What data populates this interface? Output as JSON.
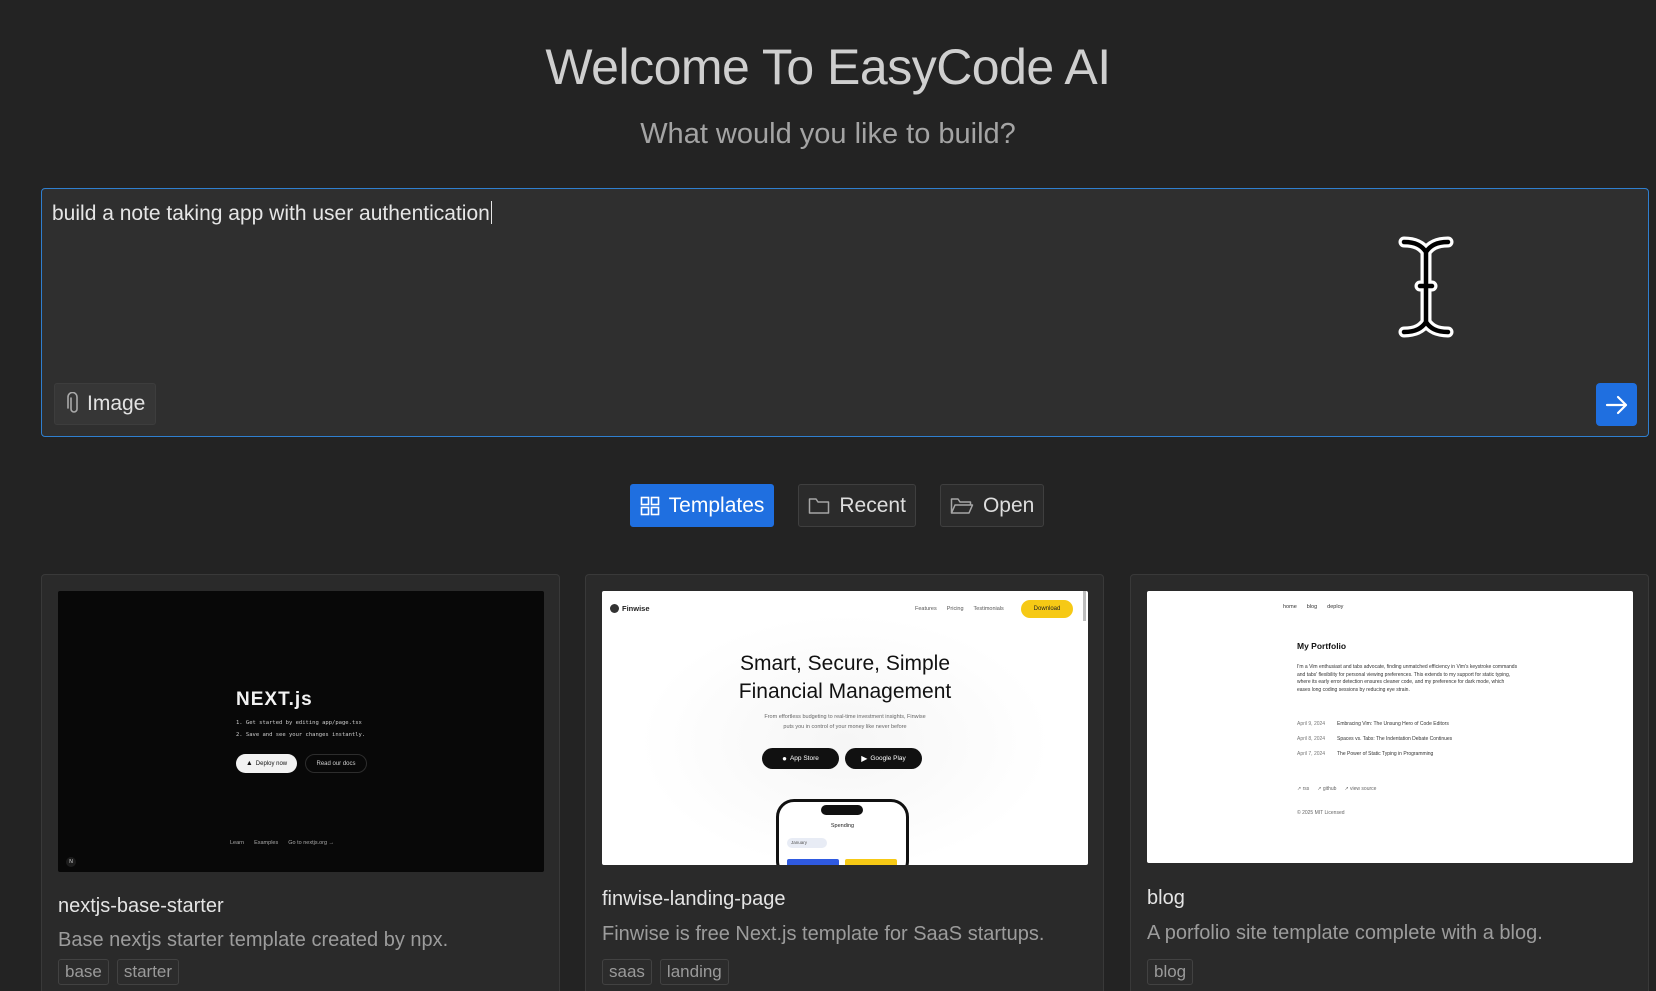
{
  "header": {
    "title": "Welcome To EasyCode AI",
    "subtitle": "What would you like to build?"
  },
  "prompt": {
    "value": "build a note taking app with user authentication",
    "image_button_label": "Image",
    "attach_icon": "paperclip-icon",
    "send_icon": "arrow-right-icon"
  },
  "tabs": [
    {
      "label": "Templates",
      "icon": "grid-icon",
      "active": true
    },
    {
      "label": "Recent",
      "icon": "folder-icon",
      "active": false
    },
    {
      "label": "Open",
      "icon": "folder-open-icon",
      "active": false
    }
  ],
  "templates": [
    {
      "name": "nextjs-base-starter",
      "description": "Base nextjs starter template created by npx.",
      "tags": [
        "base",
        "starter"
      ],
      "preview": {
        "logo": "NEXT.js",
        "step1": "1. Get started by editing app/page.tsx",
        "step2": "2. Save and see your changes instantly.",
        "primary_btn": "Deploy now",
        "secondary_btn": "Read our docs",
        "footer": [
          "Learn",
          "Examples",
          "Go to nextjs.org →"
        ]
      }
    },
    {
      "name": "finwise-landing-page",
      "description": "Finwise is free Next.js template for SaaS startups.",
      "tags": [
        "saas",
        "landing"
      ],
      "preview": {
        "brand": "Finwise",
        "nav": [
          "Features",
          "Pricing",
          "Testimonials"
        ],
        "cta": "Download",
        "headline_1": "Smart, Secure, Simple",
        "headline_2": "Financial Management",
        "body_1": "From effortless budgeting to real-time investment insights, Finwise",
        "body_2": "puts you in control of your money like never before",
        "store_1": "App Store",
        "store_2": "Google Play",
        "phone_label": "Spending",
        "phone_select": "January"
      }
    },
    {
      "name": "blog",
      "description": "A porfolio site template complete with a blog.",
      "tags": [
        "blog"
      ],
      "preview": {
        "nav": [
          "home",
          "blog",
          "deploy"
        ],
        "heading": "My Portfolio",
        "bio": "I'm a Vim enthusiast and tabs advocate, finding unmatched efficiency in Vim's keystroke commands and tabs' flexibility for personal viewing preferences. This extends to my support for static typing, where its early error detection ensures cleaner code, and my preference for dark mode, which eases long coding sessions by reducing eye strain.",
        "posts": [
          {
            "date": "April 9, 2024",
            "title": "Embracing Vim: The Unsung Hero of Code Editors"
          },
          {
            "date": "April 8, 2024",
            "title": "Spaces vs. Tabs: The Indentation Debate Continues"
          },
          {
            "date": "April 7, 2024",
            "title": "The Power of Static Typing in Programming"
          }
        ],
        "links": [
          "↗ rss",
          "↗ github",
          "↗ view source"
        ],
        "license": "© 2025 MIT Licensed"
      }
    }
  ],
  "colors": {
    "background": "#232323",
    "accent": "#1f6fe0",
    "focus_border": "#2f7fcf"
  }
}
